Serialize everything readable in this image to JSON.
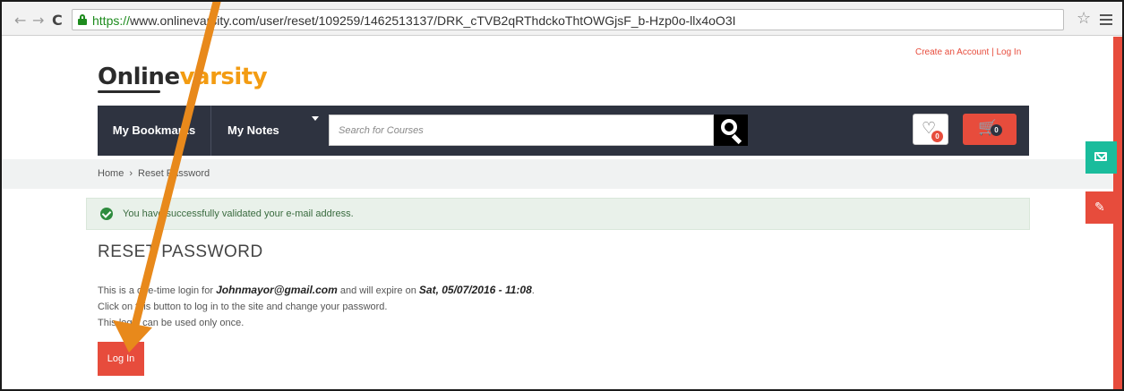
{
  "browser": {
    "url_scheme": "https://",
    "url_rest": "www.onlinevarsity.com/user/reset/109259/1462513137/DRK_cTVB2qRThdckoThtOWGjsF_b-Hzp0o-llx4oO3I",
    "back_icon": "back-arrow-icon",
    "forward_icon": "forward-arrow-icon",
    "reload_icon": "reload-icon",
    "bookmark_icon": "star-icon",
    "menu_icon": "hamburger-menu-icon"
  },
  "header": {
    "create_account": "Create an Account",
    "separator": "|",
    "log_in": "Log In",
    "logo_part1": "Online",
    "logo_part2": "varsity"
  },
  "nav": {
    "bookmarks": "My Bookmarks",
    "notes": "My Notes",
    "search_placeholder": "Search for Courses",
    "wishlist_count": "0",
    "cart_count": "0"
  },
  "breadcrumb": {
    "home": "Home",
    "separator": "›",
    "current": "Reset Password"
  },
  "alert": {
    "message": "You have successfully validated your e-mail address."
  },
  "main": {
    "title": "RESET PASSWORD",
    "line1_pre": "This is a one-time login for ",
    "email": "Johnmayor@gmail.com",
    "line1_mid": " and will expire on ",
    "expiry": "Sat, 05/07/2016 - 11:08",
    "line1_end": ".",
    "line2": "Click on this button to log in to the site and change your password.",
    "line3": "This login can be used only once.",
    "login_button": "Log In"
  },
  "colors": {
    "accent_red": "#e74c3c",
    "navbar_dark": "#2e3340",
    "logo_orange": "#f39c12",
    "teal": "#1abc9c",
    "annotation_arrow": "#f39c12"
  }
}
